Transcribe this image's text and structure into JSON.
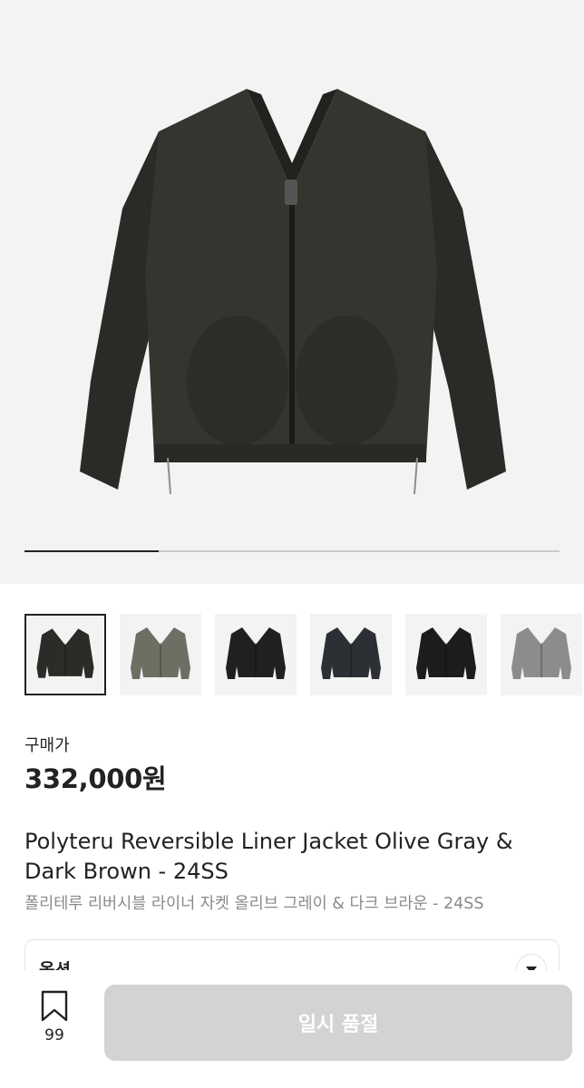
{
  "gallery": {
    "progress_fraction": 0.25,
    "thumbnails": [
      {
        "alt": "olive-gray-jacket",
        "color": "#2b2c28",
        "selected": true
      },
      {
        "alt": "sage-jacket",
        "color": "#6b7063",
        "selected": false
      },
      {
        "alt": "black-jacket",
        "color": "#1f2022",
        "selected": false
      },
      {
        "alt": "charcoal-jacket",
        "color": "#2c2f33",
        "selected": false
      },
      {
        "alt": "black-jacket-2",
        "color": "#1b1c1e",
        "selected": false
      },
      {
        "alt": "light-gray-jacket",
        "color": "#8b8c8c",
        "selected": false
      }
    ]
  },
  "product": {
    "price_label": "구매가",
    "price": "332,000원",
    "title": "Polyteru Reversible Liner Jacket Olive Gray & Dark Brown - 24SS",
    "subtitle": "폴리테루 리버시블 라이너 자켓 올리브 그레이 & 다크 브라운 - 24SS"
  },
  "option": {
    "label": "옵션",
    "icon": "chevron-down-icon"
  },
  "bottom_bar": {
    "bookmark_icon": "bookmark-icon",
    "bookmark_count": "99",
    "cta_label": "일시 품절"
  },
  "colors": {
    "cta_disabled": "#d3d3d3",
    "text_primary": "#222222",
    "text_secondary": "#8a8a8a"
  }
}
